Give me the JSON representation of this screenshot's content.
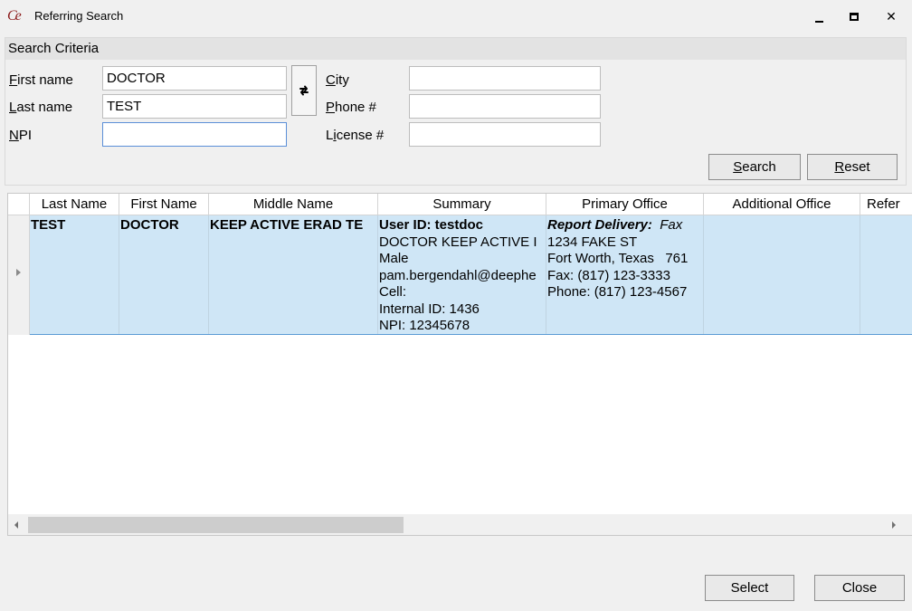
{
  "window": {
    "title": "Referring Search",
    "app_icon": "ce-logo-icon",
    "minimize_glyph": "minimize-icon",
    "maximize_glyph": "maximize-icon",
    "close_glyph": "✕"
  },
  "criteria": {
    "header": "Search Criteria",
    "fields": {
      "first_name": {
        "label_ul": "F",
        "label_rest": "irst name",
        "value": ""
      },
      "last_name": {
        "label_ul": "L",
        "label_rest": "ast name",
        "value": ""
      },
      "npi": {
        "label_ul": "N",
        "label_rest": "PI",
        "value": ""
      },
      "city": {
        "label_ul": "C",
        "label_rest": "ity",
        "value": ""
      },
      "phone": {
        "label_ul": "P",
        "label_rest": "hone #",
        "value": ""
      },
      "license": {
        "label_pre": "L",
        "label_ul": "i",
        "label_rest": "cense #",
        "value": ""
      }
    },
    "first_name_value": "DOCTOR",
    "last_name_value": "TEST",
    "swap_icon": "swap-arrows-icon",
    "search_ul": "S",
    "search_rest": "earch",
    "reset_ul": "R",
    "reset_rest": "eset"
  },
  "grid": {
    "columns": [
      "Last Name",
      "First Name",
      "Middle Name",
      "Summary",
      "Primary Office",
      "Additional Office",
      "Refer"
    ],
    "row": {
      "last_name": "TEST",
      "first_name": "DOCTOR",
      "middle_name": "KEEP ACTIVE ERAD TE",
      "summary": {
        "user_id": "User ID: testdoc",
        "full_name": "DOCTOR KEEP ACTIVE I",
        "gender": "Male",
        "email": "pam.bergendahl@deephe",
        "cell": "Cell:",
        "internal_id": "Internal ID: 1436",
        "npi": "NPI: 12345678"
      },
      "primary_office": {
        "delivery_label": "Report Delivery:",
        "delivery_value": "Fax",
        "address": "1234 FAKE ST",
        "city_state": "Fort Worth, Texas   761",
        "fax": "Fax: (817) 123-3333",
        "phone": "Phone: (817) 123-4567"
      },
      "additional_office": "",
      "refer": ""
    }
  },
  "footer": {
    "select": "Select",
    "close": "Close"
  }
}
